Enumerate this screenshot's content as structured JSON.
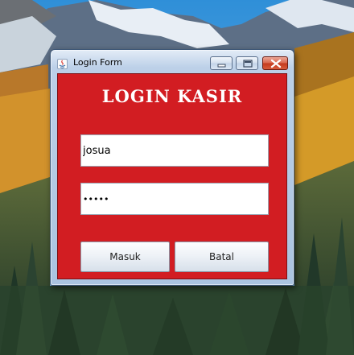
{
  "window": {
    "title": "Login Form",
    "icon": "java-icon",
    "controls": [
      "minimize",
      "maximize",
      "close"
    ]
  },
  "form": {
    "heading": "LOGIN KASIR",
    "username_value": "josua",
    "password_value": "•••••",
    "buttons": {
      "login_label": "Masuk",
      "cancel_label": "Batal"
    }
  },
  "colors": {
    "panel_background": "#d21d22",
    "heading_text": "#ffffff",
    "close_button": "#c3391c"
  }
}
